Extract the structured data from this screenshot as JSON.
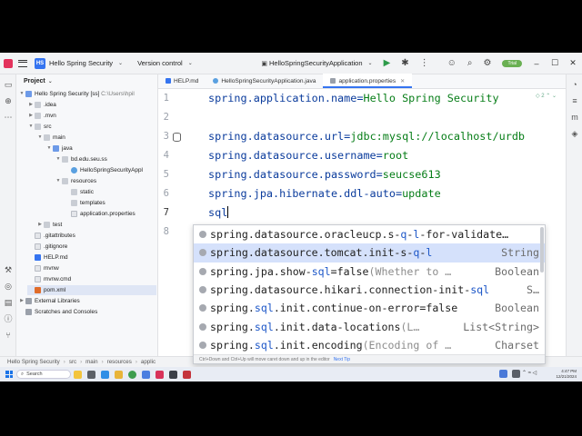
{
  "titlebar": {
    "project_name": "Hello Spring Security",
    "project_badge": "HS",
    "version_control": "Version control",
    "run_config": "HelloSpringSecurityApplication",
    "update_label": "Trial"
  },
  "project_panel": {
    "title": "Project",
    "root_name": "Hello Spring Security [ss]",
    "root_path": "C:\\Users\\hpil",
    "items": [
      {
        "label": ".idea"
      },
      {
        "label": ".mvn"
      },
      {
        "label": "src"
      },
      {
        "label": "main"
      },
      {
        "label": "java"
      },
      {
        "label": "bd.edu.seu.ss"
      },
      {
        "label": "HelloSpringSecurityAppl"
      },
      {
        "label": "resources"
      },
      {
        "label": "static"
      },
      {
        "label": "templates"
      },
      {
        "label": "application.properties"
      },
      {
        "label": "test"
      },
      {
        "label": ".gitattributes"
      },
      {
        "label": ".gitignore"
      },
      {
        "label": "HELP.md"
      },
      {
        "label": "mvnw"
      },
      {
        "label": "mvnw.cmd"
      },
      {
        "label": "pom.xml"
      },
      {
        "label": "External Libraries"
      },
      {
        "label": "Scratches and Consoles"
      }
    ]
  },
  "tabs": [
    {
      "label": "HELP.md"
    },
    {
      "label": "HelloSpringSecurityApplication.java"
    },
    {
      "label": "application.properties"
    }
  ],
  "editor": {
    "hint": "2",
    "line_numbers": [
      "1",
      "2",
      "3",
      "4",
      "5",
      "6",
      "7",
      "8"
    ],
    "lines": [
      {
        "key": "spring.application.name",
        "eq": "=",
        "value": "Hello Spring Security"
      },
      {
        "key": "spring.datasource.url",
        "eq": "=",
        "value": "jdbc:mysql://localhost/urdb"
      },
      {
        "key": "spring.datasource.username",
        "eq": "=",
        "value": "root"
      },
      {
        "key": "spring.datasource.password",
        "eq": "=",
        "value": "seucse613"
      },
      {
        "key": "spring.jpa.hibernate.ddl-auto",
        "eq": "=",
        "value": "update"
      }
    ],
    "typing": "sql"
  },
  "completion": {
    "items": [
      {
        "pre": "spring.datasource.oracleucp.s-",
        "match": "q",
        "mid": "-",
        "match2": "l",
        "post": "-for-validate…",
        "hint": "",
        "type": ""
      },
      {
        "pre": "spring.datasource.tomcat.init-s-",
        "match": "q",
        "mid": "-",
        "match2": "l",
        "post": "",
        "hint": "",
        "type": "String"
      },
      {
        "pre": "spring.jpa.show-",
        "match": "sql",
        "mid": "",
        "match2": "",
        "post": "=false",
        "hint": " (Whether to …",
        "type": "Boolean"
      },
      {
        "pre": "spring.datasource.hikari.connection-init-",
        "match": "sql",
        "mid": "",
        "match2": "",
        "post": "",
        "hint": "",
        "type": "S…"
      },
      {
        "pre": "spring.",
        "match": "sql",
        "mid": "",
        "match2": "",
        "post": ".init.continue-on-error=false",
        "hint": "",
        "type": "Boolean"
      },
      {
        "pre": "spring.",
        "match": "sql",
        "mid": "",
        "match2": "",
        "post": ".init.data-locations",
        "hint": " (L…",
        "type": "List<String>"
      },
      {
        "pre": "spring.",
        "match": "sql",
        "mid": "",
        "match2": "",
        "post": ".init.encoding",
        "hint": " (Encoding of …",
        "type": "Charset"
      }
    ],
    "footer": "Ctrl+Down and Ctrl+Up will move caret down and up in the editor",
    "next_tip": "Next Tip"
  },
  "statusbar": {
    "crumbs": [
      "Hello Spring Security",
      "src",
      "main",
      "resources",
      "applic"
    ]
  },
  "taskbar": {
    "search_placeholder": "Search",
    "time": "4:47 PM",
    "date": "12/21/2024"
  }
}
